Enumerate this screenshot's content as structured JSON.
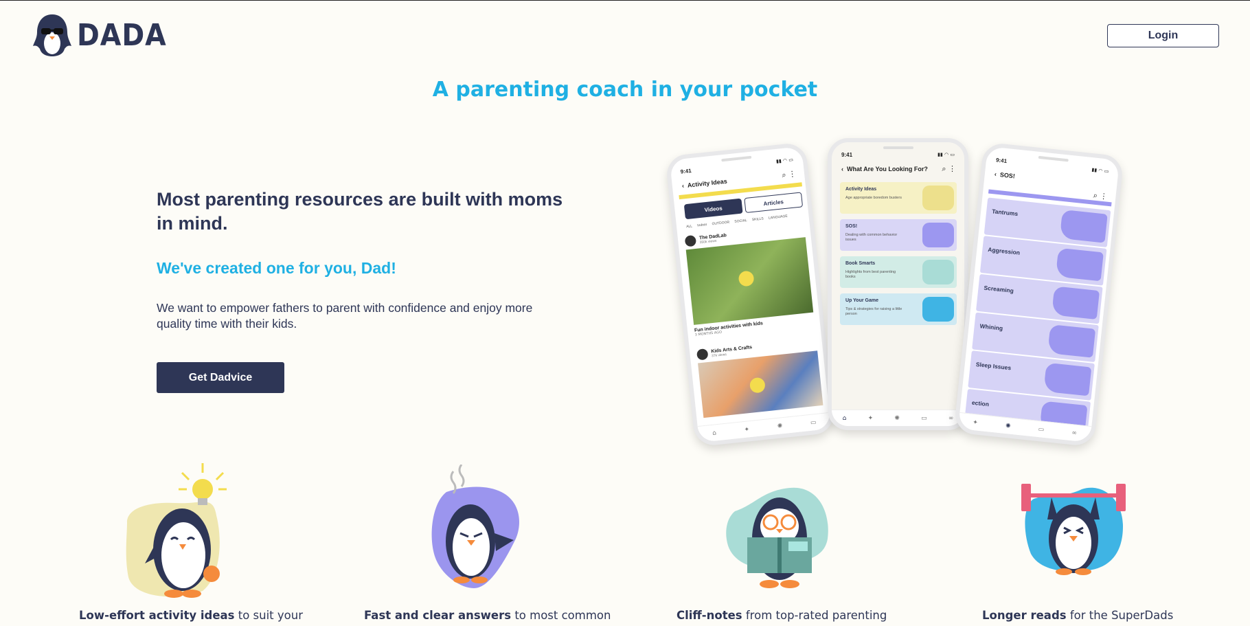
{
  "header": {
    "brand": "DADA",
    "login_label": "Login"
  },
  "tagline": "A parenting coach in your pocket",
  "hero": {
    "title": "Most parenting resources are built with moms in mind.",
    "subtitle": "We've created one for you, Dad!",
    "body": "We want to empower fathers to parent with confidence and enjoy more quality time with their kids.",
    "cta_label": "Get Dadvice"
  },
  "phones": {
    "activity": {
      "time": "9:41",
      "title": "Activity Ideas",
      "tabs": [
        "Videos",
        "Articles"
      ],
      "filters": "ALL Indoor OUTDOOR SOCIAL SKILLS LANGUAGE",
      "videos": [
        {
          "channel": "The DadLab",
          "views": "350k views",
          "caption": "Fun indoor activities with kids",
          "age": "3 MONTHS AGO"
        },
        {
          "channel": "Kids Arts & Crafts",
          "views": "37k views",
          "caption": "",
          "age": ""
        }
      ]
    },
    "search": {
      "time": "9:41",
      "title": "What Are You Looking For?",
      "cards": [
        {
          "title": "Activity Ideas",
          "desc": "Age appropriate boredom busters",
          "color": "#f6f1c5"
        },
        {
          "title": "SOS!",
          "desc": "Dealing with common behavior issues",
          "color": "#d9d6f6"
        },
        {
          "title": "Book Smarts",
          "desc": "Highlights from best parenting books",
          "color": "#d2ece6"
        },
        {
          "title": "Up Your Game",
          "desc": "Tips & strategies for raising a little person",
          "color": "#cfe9f2"
        }
      ]
    },
    "sos": {
      "time": "9:41",
      "title": "SOS!",
      "items": [
        "Tantrums",
        "Aggression",
        "Screaming",
        "Whining",
        "Sleep Issues",
        "ection"
      ]
    }
  },
  "features": [
    {
      "bold": "Low-effort activity ideas",
      "rest": " to suit your",
      "blob_color": "#efe7b0"
    },
    {
      "bold": "Fast and clear answers",
      "rest": " to most common",
      "blob_color": "#9b95ee"
    },
    {
      "bold": "Cliff-notes",
      "rest": " from top-rated parenting",
      "blob_color": "#a9dcd6"
    },
    {
      "bold": "Longer reads",
      "rest": " for the SuperDads",
      "blob_color": "#3fb4e4"
    }
  ],
  "colors": {
    "navy": "#2e3656",
    "accent_blue": "#1fb0e3",
    "background": "#fdfcf7"
  }
}
